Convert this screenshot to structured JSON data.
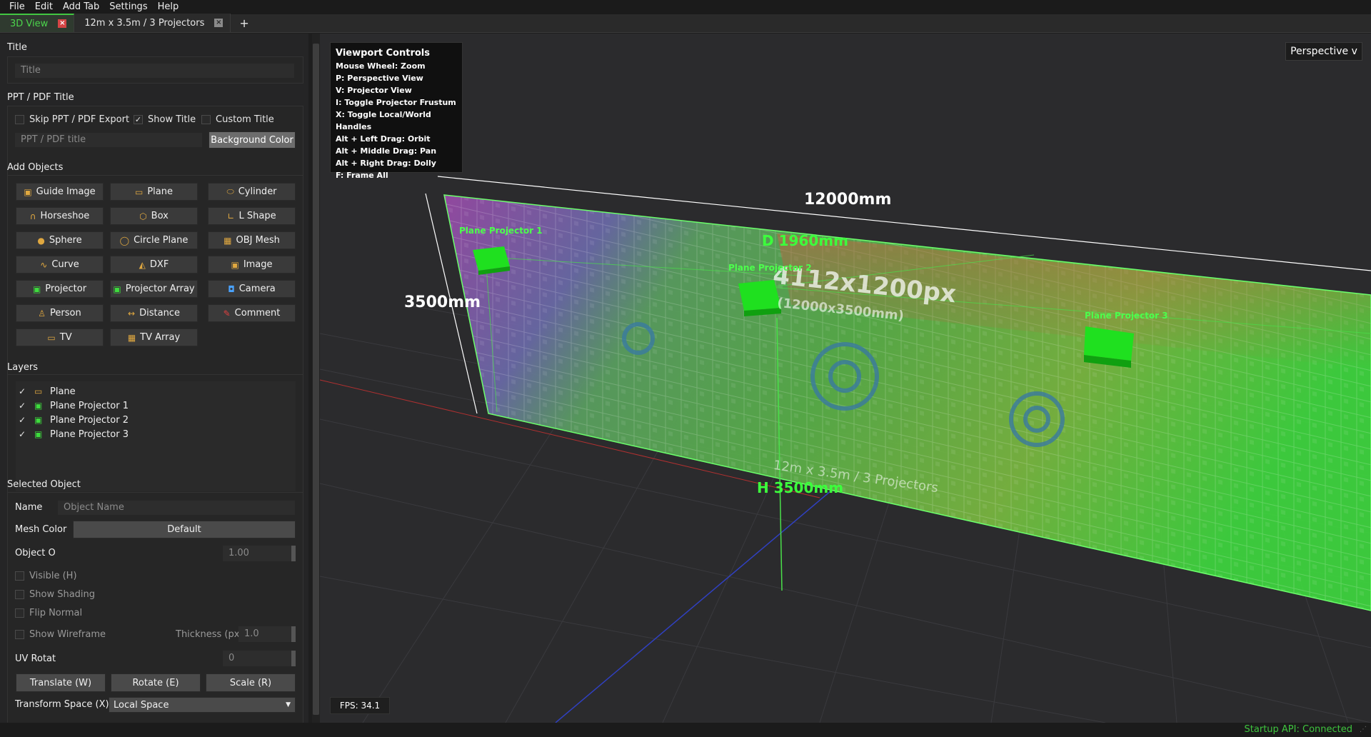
{
  "menu": [
    "File",
    "Edit",
    "Add Tab",
    "Settings",
    "Help"
  ],
  "tabs": [
    {
      "label": "3D View",
      "active": true
    },
    {
      "label": "12m x 3.5m / 3 Projectors",
      "active": false
    }
  ],
  "tab_add_label": "+",
  "panel": {
    "title_section": "Title",
    "title_placeholder": "Title",
    "ppt_section": "PPT / PDF Title",
    "skip_ppt": "Skip PPT / PDF Export",
    "show_title": "Show Title",
    "custom_title": "Custom Title",
    "ppt_placeholder": "PPT / PDF title",
    "background_color": "Background Color",
    "add_objects_section": "Add Objects",
    "objects": [
      {
        "label": "Guide Image",
        "icon": "image-icon"
      },
      {
        "label": "Plane",
        "icon": "plane-icon"
      },
      {
        "label": "Cylinder",
        "icon": "cylinder-icon"
      },
      {
        "label": "Horseshoe",
        "icon": "horseshoe-icon"
      },
      {
        "label": "Box",
        "icon": "box-icon"
      },
      {
        "label": "L Shape",
        "icon": "l-shape-icon"
      },
      {
        "label": "Sphere",
        "icon": "sphere-icon"
      },
      {
        "label": "Circle Plane",
        "icon": "circle-plane-icon"
      },
      {
        "label": "OBJ Mesh",
        "icon": "obj-mesh-icon"
      },
      {
        "label": "Curve",
        "icon": "curve-icon"
      },
      {
        "label": "DXF",
        "icon": "dxf-icon"
      },
      {
        "label": "Image",
        "icon": "image-icon"
      },
      {
        "label": "Projector",
        "icon": "projector-icon"
      },
      {
        "label": "Projector Array",
        "icon": "projector-array-icon"
      },
      {
        "label": "Camera",
        "icon": "camera-icon"
      },
      {
        "label": "Person",
        "icon": "person-icon"
      },
      {
        "label": "Distance",
        "icon": "distance-icon"
      },
      {
        "label": "Comment",
        "icon": "comment-icon"
      },
      {
        "label": "TV",
        "icon": "tv-icon"
      },
      {
        "label": "TV Array",
        "icon": "tv-array-icon"
      }
    ],
    "layers_section": "Layers",
    "layers": [
      {
        "label": "Plane",
        "icon": "plane-icon",
        "checked": true
      },
      {
        "label": "Plane Projector 1",
        "icon": "projector-icon",
        "checked": true
      },
      {
        "label": "Plane Projector 2",
        "icon": "projector-icon",
        "checked": true
      },
      {
        "label": "Plane Projector 3",
        "icon": "projector-icon",
        "checked": true
      }
    ],
    "selected_section": "Selected Object",
    "name_label": "Name",
    "name_placeholder": "Object Name",
    "mesh_color_label": "Mesh Color",
    "mesh_color_value": "Default",
    "opacity_label": "Object O",
    "opacity_value": "1.00",
    "visible_label": "Visible (H)",
    "shading_label": "Show Shading",
    "flip_label": "Flip Normal",
    "wireframe_label": "Show Wireframe",
    "thickness_label": "Thickness (px)",
    "thickness_value": "1.0",
    "uv_label": "UV Rotat",
    "uv_value": "0",
    "translate_label": "Translate (W)",
    "rotate_label": "Rotate (E)",
    "scale_label": "Scale (R)",
    "transform_label": "Transform Space (X)",
    "transform_value": "Local Space"
  },
  "viewport": {
    "controls_title": "Viewport Controls",
    "controls": [
      "Mouse Wheel: Zoom",
      "P: Perspective View",
      "V: Projector View",
      "I: Toggle Projector Frustum",
      "X: Toggle Local/World Handles",
      "Alt + Left Drag: Orbit",
      "Alt + Middle Drag: Pan",
      "Alt + Right Drag: Dolly",
      "F: Frame All"
    ],
    "perspective_label": "Perspective v",
    "fps": "FPS: 34.1",
    "width_dim": "12000mm",
    "height_dim": "3500mm",
    "depth_label": "D 1960mm",
    "h_label": "H 3500mm",
    "resolution": "4112x1200px",
    "resolution_sub": "(12000x3500mm)",
    "screen_name": "12m x 3.5m / 3 Projectors",
    "projector_labels": [
      "Plane Projector 1",
      "Plane Projector 2",
      "Plane Projector 3"
    ]
  },
  "status": "Startup API: Connected",
  "colors": {
    "accent_green": "#42c742",
    "projector_green": "#19e019",
    "status_green": "#3ec43e",
    "tab_close_red": "#d44545"
  }
}
